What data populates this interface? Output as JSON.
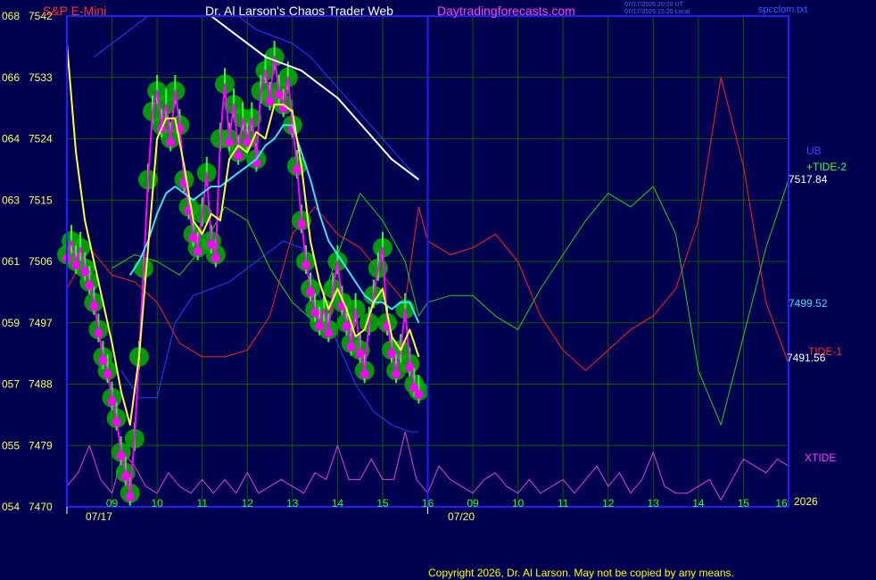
{
  "header": {
    "symbol": "S&P E-Mini",
    "site_title": "Dr. Al Larson's Chaos Trader Web",
    "site_url": "Daytradingforecasts.com",
    "stamp_ut": "07/17/2026 20:20 UT",
    "stamp_local": "07/17/2026 15:20 Local",
    "file_name": "spcclom.txt"
  },
  "right_labels": {
    "ub": "UB",
    "tide2": "+TIDE-2",
    "ub_value": "7517.84",
    "mid_value": "7499.52",
    "tide1": "TIDE-1",
    "lb_value": "7491.56",
    "xtide": "XTIDE",
    "year": "2026"
  },
  "dates": [
    "07/17",
    "07/20"
  ],
  "copyright": "Copyright 2026, Dr. Al Larson. May not be copied by any means.",
  "colors": {
    "background": "#000050",
    "grid": "#006000",
    "frame": "#2020ff",
    "price": "#ff00ff",
    "price_dots": "#ff00ff",
    "green_glow": "#00b000",
    "bright_green": "#30ff30",
    "ma_fast": "#ffff40",
    "ma_slow": "#40e0ff",
    "ma_long": "#ffffff",
    "bands": "#2040ff",
    "tide1": "#ff2020",
    "tide2": "#20d020",
    "xtide": "#e040e0"
  },
  "chart_data": {
    "type": "line",
    "title": "S&P E-Mini",
    "y_ticks": [
      {
        "left": "068",
        "right": "7542"
      },
      {
        "left": "066",
        "right": "7533"
      },
      {
        "left": "064",
        "right": "7524"
      },
      {
        "left": "063",
        "right": "7515"
      },
      {
        "left": "061",
        "right": "7506"
      },
      {
        "left": "059",
        "right": "7497"
      },
      {
        "left": "057",
        "right": "7488"
      },
      {
        "left": "055",
        "right": "7479"
      },
      {
        "left": "054",
        "right": "7470"
      }
    ],
    "ylim": [
      7470,
      7542
    ],
    "x_ticks_day1": [
      "09",
      "10",
      "11",
      "12",
      "13",
      "14",
      "15",
      "16"
    ],
    "x_ticks_day2": [
      "09",
      "10",
      "11",
      "12",
      "13",
      "14",
      "15",
      "16"
    ],
    "xlim": [
      0,
      16
    ],
    "grid": true,
    "series": [
      {
        "name": "price",
        "x": [
          0,
          0.1,
          0.2,
          0.3,
          0.4,
          0.5,
          0.6,
          0.7,
          0.8,
          0.9,
          1.0,
          1.1,
          1.2,
          1.3,
          1.4,
          1.5,
          1.6,
          1.7,
          1.8,
          1.9,
          2.0,
          2.1,
          2.2,
          2.3,
          2.4,
          2.5,
          2.6,
          2.7,
          2.8,
          2.9,
          3.0,
          3.1,
          3.2,
          3.3,
          3.4,
          3.5,
          3.6,
          3.7,
          3.8,
          3.9,
          4.0,
          4.1,
          4.2,
          4.3,
          4.4,
          4.5,
          4.6,
          4.7,
          4.8,
          4.9,
          5.0,
          5.1,
          5.2,
          5.3,
          5.4,
          5.5,
          5.6,
          5.7,
          5.8,
          5.9,
          6.0,
          6.1,
          6.2,
          6.3,
          6.4,
          6.5,
          6.6,
          6.7,
          6.8,
          6.9,
          7.0,
          7.1,
          7.2,
          7.3,
          7.4,
          7.5,
          7.6,
          7.7,
          7.8
        ],
        "values": [
          7507,
          7509,
          7506,
          7508,
          7505,
          7503,
          7500,
          7496,
          7492,
          7490,
          7486,
          7483,
          7478,
          7475,
          7472,
          7480,
          7492,
          7505,
          7518,
          7528,
          7531,
          7526,
          7529,
          7524,
          7531,
          7526,
          7518,
          7514,
          7510,
          7508,
          7513,
          7519,
          7509,
          7507,
          7524,
          7532,
          7524,
          7529,
          7522,
          7527,
          7524,
          7527,
          7521,
          7531,
          7534,
          7530,
          7536,
          7531,
          7529,
          7533,
          7526,
          7520,
          7512,
          7506,
          7502,
          7499,
          7497,
          7499,
          7496,
          7502,
          7506,
          7500,
          7497,
          7494,
          7499,
          7493,
          7490,
          7497,
          7501,
          7505,
          7508,
          7497,
          7493,
          7490,
          7493,
          7499,
          7491,
          7488,
          7487
        ]
      },
      {
        "name": "ma_fast",
        "x": [
          0,
          0.2,
          0.4,
          0.6,
          0.8,
          1.0,
          1.2,
          1.4,
          1.6,
          1.8,
          2.0,
          2.2,
          2.4,
          2.6,
          2.8,
          3.0,
          3.2,
          3.4,
          3.6,
          3.8,
          4.0,
          4.2,
          4.4,
          4.6,
          4.8,
          5.0,
          5.2,
          5.4,
          5.6,
          5.8,
          6.0,
          6.2,
          6.4,
          6.6,
          6.8,
          7.0,
          7.2,
          7.4,
          7.6,
          7.8
        ],
        "values": [
          7538,
          7522,
          7512,
          7506,
          7500,
          7494,
          7487,
          7482,
          7492,
          7508,
          7524,
          7527,
          7527,
          7520,
          7512,
          7510,
          7513,
          7512,
          7521,
          7523,
          7522,
          7525,
          7524,
          7529,
          7529,
          7528,
          7520,
          7509,
          7503,
          7499,
          7502,
          7499,
          7495,
          7496,
          7500,
          7502,
          7495,
          7493,
          7496,
          7492
        ]
      },
      {
        "name": "ma_slow",
        "x": [
          1.4,
          1.6,
          1.8,
          2.0,
          2.2,
          2.4,
          2.6,
          2.8,
          3.0,
          3.2,
          3.4,
          3.6,
          3.8,
          4.0,
          4.2,
          4.4,
          4.6,
          4.8,
          5.0,
          5.2,
          5.4,
          5.6,
          5.8,
          6.0,
          6.2,
          6.4,
          6.6,
          6.8,
          7.0,
          7.2,
          7.4,
          7.6,
          7.8
        ],
        "values": [
          7504,
          7506,
          7509,
          7513,
          7516,
          7517,
          7516,
          7515,
          7516,
          7517,
          7517,
          7518,
          7519,
          7520,
          7521,
          7523,
          7524,
          7526,
          7526,
          7522,
          7518,
          7513,
          7509,
          7507,
          7505,
          7503,
          7501,
          7500,
          7500,
          7499,
          7500,
          7500,
          7497
        ]
      },
      {
        "name": "ma_long",
        "x": [
          3.2,
          3.6,
          4.0,
          4.4,
          4.8,
          5.2,
          5.6,
          6.0,
          6.4,
          6.8,
          7.2,
          7.6,
          7.8
        ],
        "values": [
          7542,
          7540,
          7538,
          7536,
          7535,
          7534,
          7532,
          7530,
          7527,
          7524,
          7521,
          7519,
          7518
        ]
      },
      {
        "name": "upper_band",
        "x": [
          0.6,
          1.0,
          1.4,
          1.8,
          2.2,
          2.6,
          3.0,
          3.4,
          3.8,
          4.2,
          4.6,
          5.0,
          5.4,
          5.8,
          6.2,
          6.6,
          7.0,
          7.4,
          7.8
        ],
        "values": [
          7536,
          7538,
          7540,
          7542,
          7542,
          7542,
          7542,
          7542,
          7542,
          7540,
          7539,
          7538,
          7536,
          7533,
          7530,
          7527,
          7524,
          7521,
          7518
        ]
      },
      {
        "name": "lower_band",
        "x": [
          1.2,
          1.6,
          2.0,
          2.4,
          2.8,
          3.2,
          3.6,
          4.0,
          4.4,
          4.8,
          5.2,
          5.6,
          6.0,
          6.4,
          6.8,
          7.2,
          7.6,
          7.8
        ],
        "values": [
          7490,
          7486,
          7486,
          7497,
          7501,
          7502,
          7503,
          7505,
          7507,
          7509,
          7508,
          7501,
          7494,
          7488,
          7484,
          7482,
          7481,
          7481
        ]
      },
      {
        "name": "TIDE-1",
        "x": [
          0,
          0.5,
          1.0,
          1.5,
          2.0,
          2.5,
          3.0,
          3.5,
          4.0,
          4.5,
          5.0,
          5.5,
          6.0,
          6.5,
          7.0,
          7.5,
          7.8,
          8.0,
          8.5,
          9.0,
          9.5,
          10.0,
          10.5,
          11.0,
          11.5,
          12.0,
          12.5,
          13.0,
          13.5,
          14.0,
          14.5,
          15.0,
          15.5,
          16.0
        ],
        "values": [
          7502,
          7508,
          7504,
          7503,
          7500,
          7494,
          7492,
          7492,
          7493,
          7498,
          7510,
          7514,
          7510,
          7508,
          7504,
          7500,
          7514,
          7509,
          7507,
          7508,
          7510,
          7506,
          7498,
          7493,
          7490,
          7493,
          7496,
          7498,
          7502,
          7512,
          7533,
          7520,
          7500,
          7491
        ]
      },
      {
        "name": "+TIDE-2",
        "x": [
          1.0,
          1.5,
          2.0,
          2.5,
          3.0,
          3.5,
          4.0,
          4.5,
          5.0,
          5.5,
          6.0,
          6.5,
          7.0,
          7.5,
          7.8,
          8.0,
          8.5,
          9.0,
          9.5,
          10.0,
          10.5,
          11.0,
          11.5,
          12.0,
          12.5,
          13.0,
          13.5,
          14.0,
          14.5,
          15.0,
          15.5,
          16.0
        ],
        "values": [
          7505,
          7507,
          7506,
          7504,
          7508,
          7514,
          7512,
          7505,
          7500,
          7497,
          7507,
          7516,
          7512,
          7506,
          7498,
          7500,
          7501,
          7501,
          7498,
          7496,
          7502,
          7507,
          7512,
          7516,
          7514,
          7517,
          7510,
          7490,
          7482,
          7495,
          7508,
          7518
        ]
      },
      {
        "name": "XTIDE",
        "x": [
          0,
          0.25,
          0.5,
          0.75,
          1.0,
          1.25,
          1.5,
          1.75,
          2.0,
          2.25,
          2.5,
          2.75,
          3.0,
          3.25,
          3.5,
          3.75,
          4.0,
          4.25,
          4.5,
          4.75,
          5.0,
          5.25,
          5.5,
          5.75,
          6.0,
          6.25,
          6.5,
          6.75,
          7.0,
          7.25,
          7.5,
          7.75,
          8.0,
          8.25,
          8.5,
          8.75,
          9.0,
          9.25,
          9.5,
          9.75,
          10.0,
          10.25,
          10.5,
          10.75,
          11.0,
          11.25,
          11.5,
          11.75,
          12.0,
          12.25,
          12.5,
          12.75,
          13.0,
          13.25,
          13.5,
          13.75,
          14.0,
          14.25,
          14.5,
          14.75,
          15.0,
          15.25,
          15.5,
          15.75,
          16.0
        ],
        "values": [
          7473,
          7475,
          7479,
          7474,
          7472,
          7478,
          7476,
          7473,
          7472,
          7475,
          7473,
          7472,
          7474,
          7472,
          7474,
          7472,
          7475,
          7472,
          7473,
          7474,
          7473,
          7472,
          7475,
          7474,
          7479,
          7474,
          7474,
          7477,
          7474,
          7474,
          7481,
          7474,
          7472,
          7476,
          7474,
          7473,
          7472,
          7474,
          7475,
          7473,
          7472,
          7474,
          7472,
          7473,
          7474,
          7472,
          7474,
          7476,
          7473,
          7475,
          7472,
          7474,
          7478,
          7473,
          7472,
          7472,
          7473,
          7474,
          7471,
          7474,
          7477,
          7476,
          7475,
          7477,
          7476
        ]
      }
    ]
  }
}
